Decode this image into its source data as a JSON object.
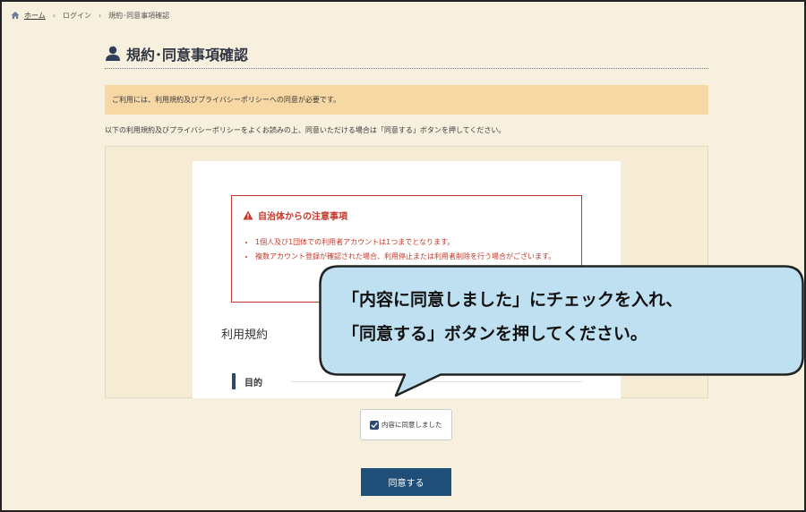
{
  "breadcrumb": {
    "home": "ホーム",
    "sep": "›",
    "login": "ログイン",
    "current": "規約･同意事項確認"
  },
  "page": {
    "title": "規約･同意事項確認",
    "notice": "ご利用には、利用規約及びプライバシーポリシーへの同意が必要です。",
    "instruction": "以下の利用規約及びプライバシーポリシーをよくお読みの上、同意いただける場合は「同意する」ボタンを押してください。"
  },
  "document": {
    "warning_title": "自治体からの注意事項",
    "warning_items": [
      "1個人及び1団体での利用者アカウントは1つまでとなります。",
      "複数アカウント登録が確認された場合、利用停止または利用者削除を行う場合がございます。"
    ],
    "terms_title": "利用規約",
    "section_purpose": "目的"
  },
  "agree_checkbox_label": "内容に同意しました",
  "agree_checked": true,
  "agree_button": "同意する",
  "callout": {
    "line1": "「内容に同意しました」にチェックを入れ、",
    "line2": "「同意する」ボタンを押してください。"
  },
  "colors": {
    "background": "#f8f0df",
    "notice_bg": "#f7d8a5",
    "warning": "#c0392b",
    "button": "#1f4f78",
    "callout_bg": "#bfe0f1"
  },
  "icons": [
    "home-icon",
    "user-icon",
    "warning-icon",
    "check-icon"
  ]
}
